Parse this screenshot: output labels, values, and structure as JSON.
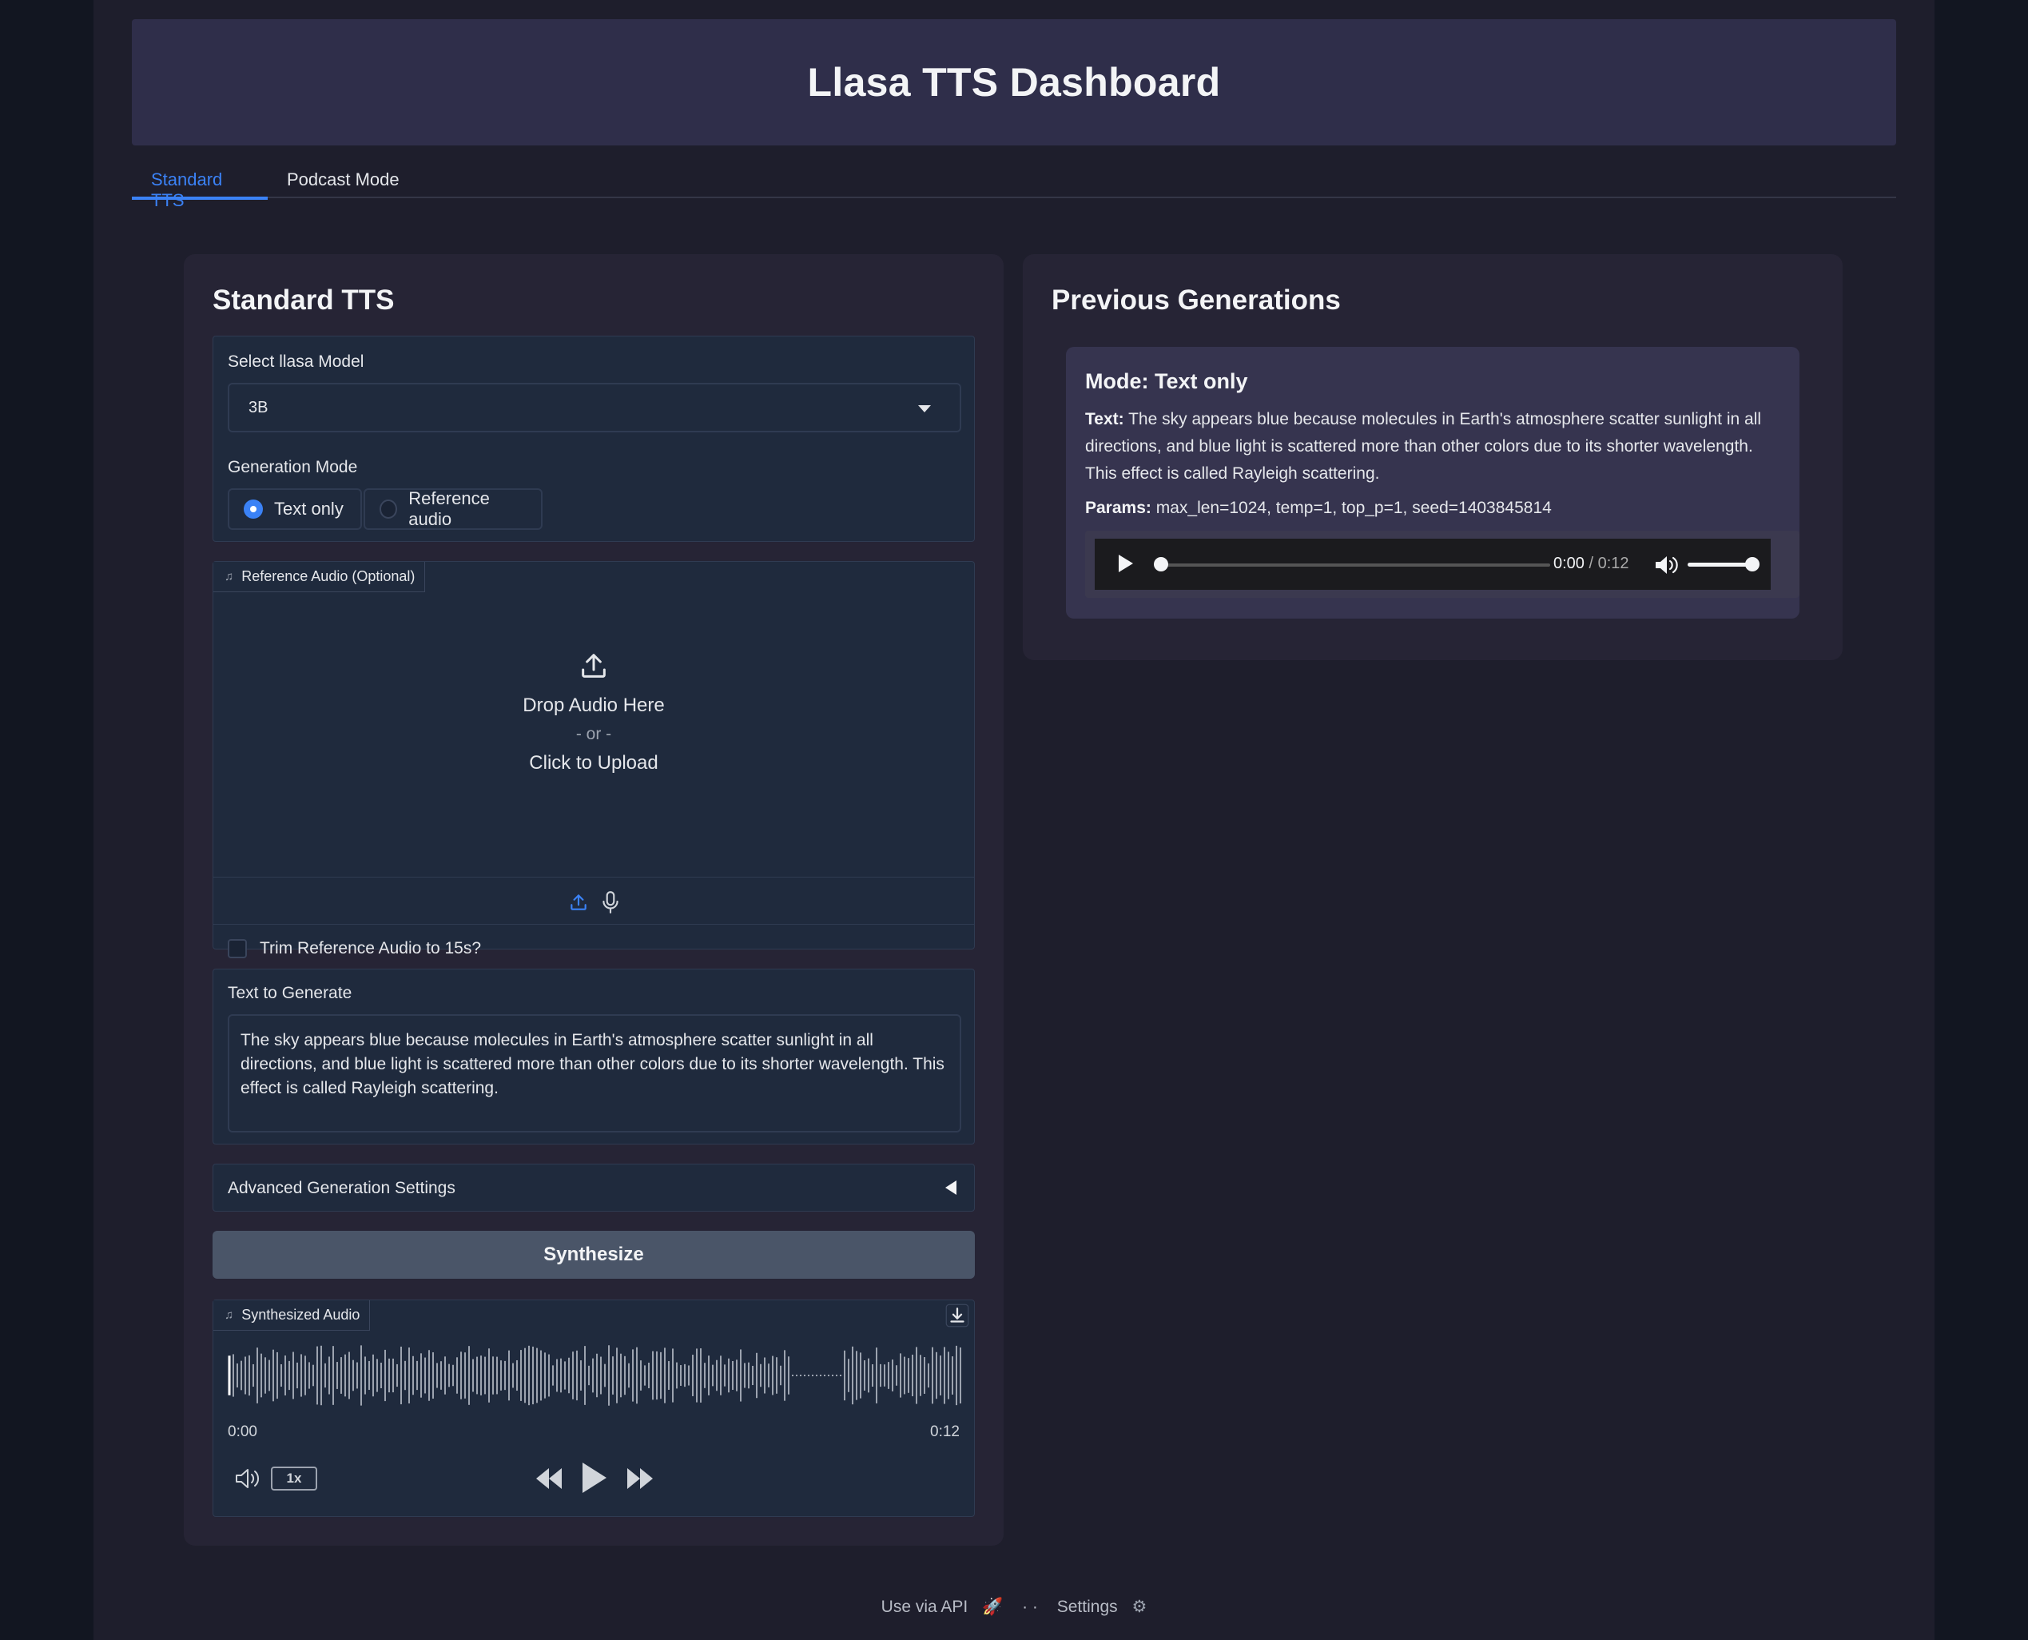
{
  "header": {
    "title": "Llasa TTS Dashboard"
  },
  "tabs": [
    {
      "label": "Standard TTS",
      "active": true
    },
    {
      "label": "Podcast Mode",
      "active": false
    }
  ],
  "left": {
    "title": "Standard TTS",
    "model": {
      "label": "Select llasa Model",
      "value": "3B"
    },
    "generation_mode": {
      "label": "Generation Mode",
      "options": [
        {
          "label": "Text only",
          "selected": true
        },
        {
          "label": "Reference audio",
          "selected": false
        }
      ]
    },
    "reference_audio": {
      "chip_label": "Reference Audio (Optional)",
      "drop_text": "Drop Audio Here",
      "or_text": "- or -",
      "click_text": "Click to Upload",
      "trim_label": "Trim Reference Audio to 15s?",
      "trim_checked": false
    },
    "text_input": {
      "label": "Text to Generate",
      "value": "The sky appears blue because molecules in Earth's atmosphere scatter sunlight in all directions, and blue light is scattered more than other colors due to its shorter wavelength. This effect is called Rayleigh scattering."
    },
    "advanced": {
      "label": "Advanced Generation Settings"
    },
    "synthesize_label": "Synthesize",
    "output": {
      "chip_label": "Synthesized Audio",
      "time_start": "0:00",
      "time_end": "0:12",
      "speed": "1x"
    }
  },
  "right": {
    "title": "Previous Generations",
    "card": {
      "mode": "Mode: Text only",
      "text_label": "Text:",
      "text": "The sky appears blue because molecules in Earth's atmosphere scatter sunlight in all directions, and blue light is scattered more than other colors due to its shorter wavelength. This effect is called Rayleigh scattering.",
      "params_label": "Params:",
      "params": "max_len=1024, temp=1, top_p=1, seed=1403845814",
      "player": {
        "current": "0:00",
        "duration": "/ 0:12",
        "progress": 0,
        "volume": 1.0
      }
    }
  },
  "footer": {
    "api": "Use via API",
    "sep": "· ·",
    "settings": "Settings"
  },
  "colors": {
    "accent": "#3b82f6",
    "background": "#1e1e2c",
    "panel": "#1f2a3d"
  }
}
